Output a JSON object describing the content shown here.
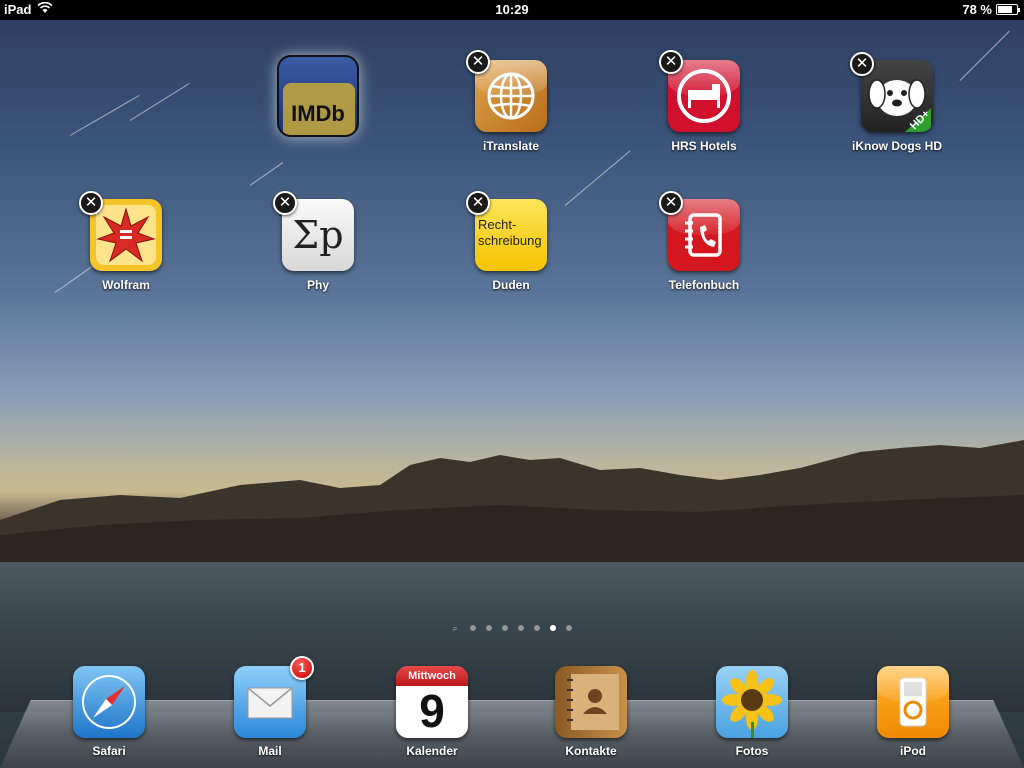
{
  "status_bar": {
    "device": "iPad",
    "time": "10:29",
    "battery": "78 %",
    "battery_level": 0.78
  },
  "home_apps": [
    {
      "label": "",
      "icon": "imdb-dragging-icon",
      "deletable": false,
      "icon_text": "IMDb"
    },
    {
      "label": "iTranslate",
      "icon": "globe-icon",
      "deletable": true
    },
    {
      "label": "HRS Hotels",
      "icon": "hotel-bed-icon",
      "deletable": true
    },
    {
      "label": "iKnow Dogs HD",
      "icon": "dog-icon",
      "deletable": true,
      "icon_text": "HD+"
    },
    {
      "label": "Wolfram",
      "icon": "wolfram-star-icon",
      "deletable": true
    },
    {
      "label": "Phy",
      "icon": "sigma-icon",
      "deletable": true,
      "icon_text": "Σp"
    },
    {
      "label": "Duden",
      "icon": "duden-icon",
      "deletable": true,
      "icon_text": "Recht-\nschreibung"
    },
    {
      "label": "Telefonbuch",
      "icon": "phonebook-icon",
      "deletable": true
    }
  ],
  "delete_symbol": "✕",
  "page_indicator": {
    "pages": 7,
    "active_index": 5
  },
  "dock_apps": [
    {
      "label": "Safari",
      "icon": "compass-icon"
    },
    {
      "label": "Mail",
      "icon": "envelope-icon",
      "badge": "1"
    },
    {
      "label": "Kalender",
      "icon": "calendar-icon",
      "icon_header": "Mittwoch",
      "icon_day": "9"
    },
    {
      "label": "Kontakte",
      "icon": "contacts-book-icon"
    },
    {
      "label": "Fotos",
      "icon": "sunflower-icon"
    },
    {
      "label": "iPod",
      "icon": "ipod-icon"
    }
  ],
  "colors": {
    "hrs_red": "#d0102c",
    "telefonbuch_red": "#d4161e",
    "duden_yellow": "#f5c400",
    "ipod_orange": "#f08a00",
    "badge_red": "#c80000"
  }
}
